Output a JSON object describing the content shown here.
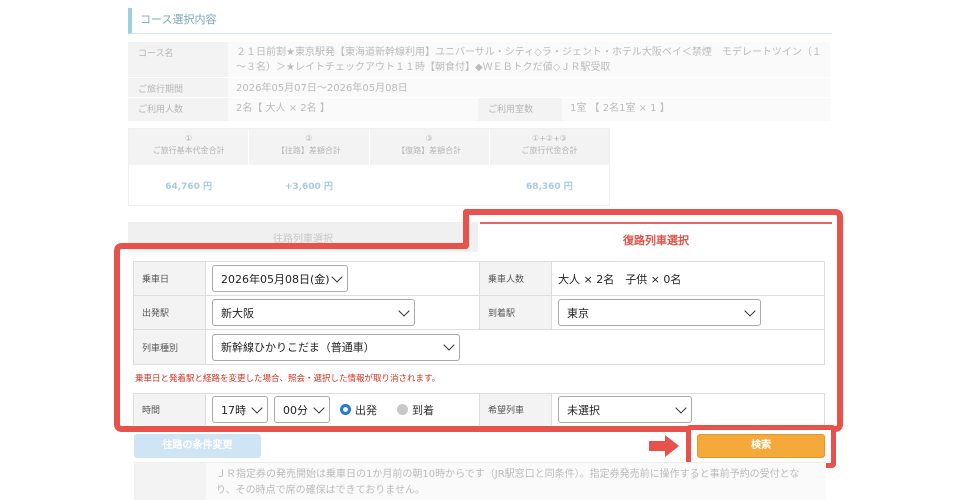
{
  "section_title": "コース選択内容",
  "course": {
    "name_label": "コース名",
    "name_value": "２１日前割★東京駅発【東海道新幹線利用】ユニバーサル・シティ◇ラ・ジェント・ホテル大阪ベイ＜禁煙　モデレートツイン（１～３名）＞★レイトチェックアウト１１時【朝食付】◆ＷＥＢトクだ値◇ＪＲ駅受取",
    "period_label": "ご旅行期間",
    "period_value": "2026年05月07日～2026年05月08日",
    "people_label": "ご利用人数",
    "people_value": "2名【 大人 × 2名 】",
    "rooms_label": "ご利用室数",
    "rooms_value": "1室 【 2名1室 × 1 】"
  },
  "prices": [
    {
      "num": "①",
      "label": "ご旅行基本代金合計",
      "value": "64,760 円"
    },
    {
      "num": "②",
      "label": "【往路】差額合計",
      "value": "+3,600 円"
    },
    {
      "num": "③",
      "label": "【復路】差額合計",
      "value": ""
    },
    {
      "num": "①+②+③",
      "label": "ご旅行代金合計",
      "value": "68,360 円"
    }
  ],
  "tabs": {
    "outbound": "往路列車選択",
    "return": "復路列車選択"
  },
  "form": {
    "date_label": "乗車日",
    "date_value": "2026年05月08日(金)",
    "pax_label": "乗車人数",
    "pax_value": "大人 × 2名　子供 × 0名",
    "from_label": "出発駅",
    "from_value": "新大阪",
    "to_label": "到着駅",
    "to_value": "東京",
    "type_label": "列車種別",
    "type_value": "新幹線ひかりこだま（普通車）",
    "warning": "乗車日と発着駅と経路を変更した場合、照会・選択した情報が取り消されます。",
    "time_label": "時間",
    "hour_value": "17時",
    "minute_value": "00分",
    "radio_depart": "出発",
    "radio_arrive": "到着",
    "train_label": "希望列車",
    "train_value": "未選択"
  },
  "buttons": {
    "outbound_conditions": "往路の条件変更",
    "search": "検索"
  },
  "note": "ＪＲ指定券の発売開始は乗車日の1か月前の朝10時からです（JR駅窓口と同条件）。指定券発売前に操作すると事前予約の受付となり、その時点で席の確保はできておりません。",
  "colors": {
    "highlight": "#e8524a",
    "accent_red": "#e0564a",
    "search_button": "#f4a93a",
    "radio_selected": "#1e7bd8"
  }
}
